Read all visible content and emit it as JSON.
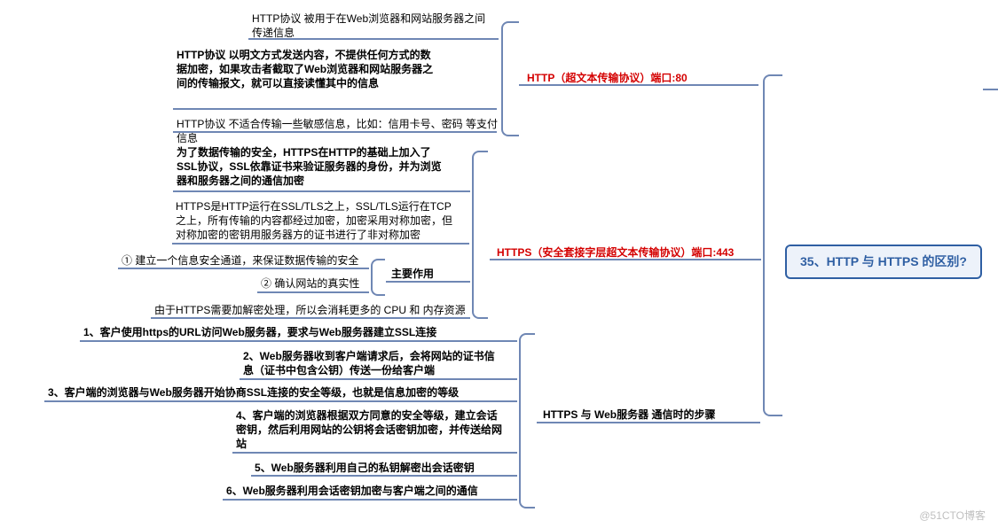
{
  "root": {
    "title": "35、HTTP 与 HTTPS 的区别?"
  },
  "watermark": "@51CTO博客",
  "branches": {
    "http": {
      "label": "HTTP（超文本传输协议）端口:80",
      "items": [
        "HTTP协议 被用于在Web浏览器和网站服务器之间传递信息",
        "HTTP协议 以明文方式发送内容，不提供任何方式的数据加密，如果攻击者截取了Web浏览器和网站服务器之间的传输报文，就可以直接读懂其中的信息",
        "HTTP协议 不适合传输一些敏感信息，比如：信用卡号、密码 等支付信息"
      ]
    },
    "https": {
      "label": "HTTPS（安全套接字层超文本传输协议）端口:443",
      "intro": "为了数据传输的安全，HTTPS在HTTP的基础上加入了SSL协议，SSL依靠证书来验证服务器的身份，并为浏览器和服务器之间的通信加密",
      "detail": "HTTPS是HTTP运行在SSL/TLS之上，SSL/TLS运行在TCP之上，所有传输的内容都经过加密，加密采用对称加密，但对称加密的密钥用服务器方的证书进行了非对称加密",
      "main_role": {
        "label": "主要作用",
        "items": [
          "① 建立一个信息安全通道，来保证数据传输的安全",
          "② 确认网站的真实性"
        ]
      },
      "note": "由于HTTPS需要加解密处理，所以会消耗更多的 CPU 和 内存资源"
    },
    "steps": {
      "label": "HTTPS 与 Web服务器 通信时的步骤",
      "items": [
        "1、客户使用https的URL访问Web服务器，要求与Web服务器建立SSL连接",
        "2、Web服务器收到客户端请求后，会将网站的证书信息（证书中包含公钥）传送一份给客户端",
        "3、客户端的浏览器与Web服务器开始协商SSL连接的安全等级，也就是信息加密的等级",
        "4、客户端的浏览器根据双方同意的安全等级，建立会话密钥，然后利用网站的公钥将会话密钥加密，并传送给网站",
        "5、Web服务器利用自己的私钥解密出会话密钥",
        "6、Web服务器利用会话密钥加密与客户端之间的通信"
      ]
    }
  }
}
